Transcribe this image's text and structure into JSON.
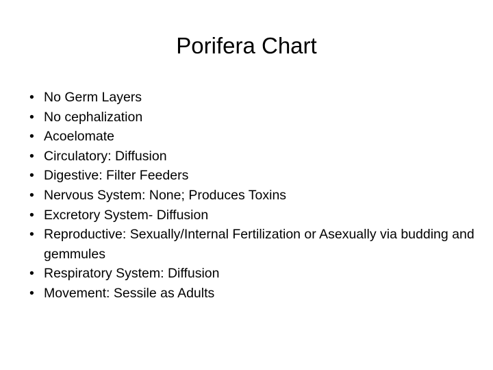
{
  "slide": {
    "title": "Porifera Chart",
    "background_color": "#FFFFFF",
    "text_color": "#000000",
    "bullet_glyph": "•",
    "items": [
      {
        "text": "No Germ Layers"
      },
      {
        "text": "No cephalization"
      },
      {
        "text": "Acoelomate"
      },
      {
        "text": "Circulatory: Diffusion"
      },
      {
        "text": "Digestive: Filter Feeders"
      },
      {
        "text": "Nervous System: None; Produces Toxins"
      },
      {
        "text": "Excretory System- Diffusion"
      },
      {
        "text": "Reproductive: Sexually/Internal Fertilization or Asexually via budding and gemmules"
      },
      {
        "text": "Respiratory System: Diffusion"
      },
      {
        "text": "Movement: Sessile as Adults"
      }
    ]
  }
}
